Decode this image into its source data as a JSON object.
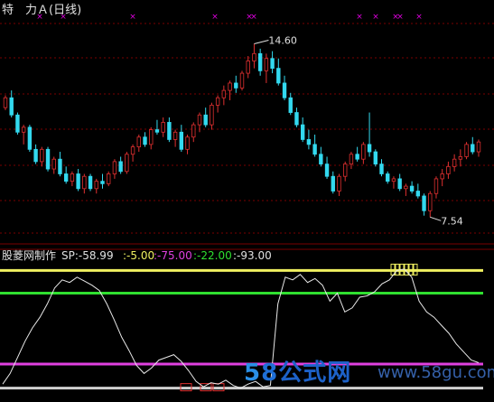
{
  "header": {
    "title": "特　力Ａ(日线)"
  },
  "price_panel": {
    "high_label": "14.60",
    "low_label": "7.54"
  },
  "indicator_header": {
    "name": "股菱网制作",
    "sp": "SP:-58.99",
    "v1": ":-5.00",
    "v2": ":-75.00",
    "v3": ":-22.00",
    "v4": ":-93.00"
  },
  "watermark": {
    "digits_a": "5",
    "digits_b": "8",
    "word": "公式网",
    "url": "www.58gu.com"
  },
  "colors": {
    "up": "#e03030",
    "down": "#33d9ef",
    "grid": "#7a0000",
    "marker": "#e000e0",
    "line_yellow": "#f0f060",
    "line_green": "#30e030",
    "line_magenta": "#e040e0",
    "line_white": "#d0d0d0"
  },
  "chart_data": [
    {
      "type": "candlestick",
      "title": "特　力Ａ(日线)",
      "annotations": [
        {
          "label": "14.60",
          "kind": "high"
        },
        {
          "label": "7.54",
          "kind": "low"
        }
      ],
      "ylim": [
        7.0,
        15.5
      ],
      "candles": [
        [
          12.0,
          12.5,
          11.9,
          12.4
        ],
        [
          12.4,
          12.7,
          11.6,
          11.7
        ],
        [
          11.7,
          11.8,
          10.9,
          11.0
        ],
        [
          11.0,
          11.3,
          10.5,
          11.2
        ],
        [
          11.2,
          11.3,
          10.2,
          10.3
        ],
        [
          10.3,
          10.5,
          9.7,
          9.8
        ],
        [
          9.8,
          10.4,
          9.6,
          10.3
        ],
        [
          10.3,
          10.4,
          9.4,
          9.5
        ],
        [
          9.5,
          10.0,
          9.3,
          9.9
        ],
        [
          9.9,
          10.2,
          9.2,
          9.3
        ],
        [
          9.3,
          9.6,
          8.9,
          9.0
        ],
        [
          9.0,
          9.4,
          8.8,
          9.3
        ],
        [
          9.3,
          9.5,
          8.6,
          8.7
        ],
        [
          8.7,
          9.3,
          8.5,
          9.2
        ],
        [
          9.2,
          9.3,
          8.6,
          8.7
        ],
        [
          8.7,
          9.1,
          8.5,
          9.0
        ],
        [
          9.0,
          9.3,
          8.7,
          8.9
        ],
        [
          8.9,
          9.4,
          8.8,
          9.3
        ],
        [
          9.3,
          9.9,
          9.1,
          9.8
        ],
        [
          9.8,
          10.0,
          9.3,
          9.4
        ],
        [
          9.4,
          10.2,
          9.3,
          10.1
        ],
        [
          10.1,
          10.5,
          9.8,
          10.4
        ],
        [
          10.4,
          10.9,
          10.2,
          10.8
        ],
        [
          10.8,
          11.0,
          10.4,
          10.5
        ],
        [
          10.5,
          11.2,
          10.3,
          11.1
        ],
        [
          11.1,
          11.5,
          10.9,
          11.0
        ],
        [
          11.0,
          11.6,
          10.8,
          11.4
        ],
        [
          11.4,
          11.6,
          10.6,
          10.7
        ],
        [
          10.7,
          11.1,
          10.4,
          11.0
        ],
        [
          11.0,
          11.3,
          10.2,
          10.3
        ],
        [
          10.3,
          10.9,
          10.1,
          10.8
        ],
        [
          10.8,
          11.4,
          10.6,
          11.3
        ],
        [
          11.3,
          11.8,
          11.0,
          11.7
        ],
        [
          11.7,
          12.0,
          11.2,
          11.3
        ],
        [
          11.3,
          12.2,
          11.1,
          12.1
        ],
        [
          12.1,
          12.5,
          11.8,
          12.4
        ],
        [
          12.4,
          12.9,
          12.1,
          12.7
        ],
        [
          12.7,
          13.1,
          12.3,
          13.0
        ],
        [
          13.0,
          13.3,
          12.6,
          12.8
        ],
        [
          12.8,
          13.5,
          12.7,
          13.4
        ],
        [
          13.4,
          14.1,
          13.2,
          13.9
        ],
        [
          13.9,
          14.6,
          13.6,
          14.2
        ],
        [
          14.2,
          14.4,
          13.3,
          13.5
        ],
        [
          13.5,
          14.2,
          13.0,
          14.0
        ],
        [
          14.0,
          14.3,
          13.4,
          13.6
        ],
        [
          13.6,
          14.0,
          12.9,
          13.0
        ],
        [
          13.0,
          13.3,
          12.3,
          12.4
        ],
        [
          12.4,
          12.6,
          11.7,
          11.8
        ],
        [
          11.8,
          12.0,
          11.2,
          11.3
        ],
        [
          11.3,
          11.6,
          10.6,
          10.7
        ],
        [
          10.7,
          11.1,
          10.3,
          10.5
        ],
        [
          10.5,
          10.9,
          10.0,
          10.1
        ],
        [
          10.1,
          10.4,
          9.6,
          9.7
        ],
        [
          9.7,
          10.0,
          9.1,
          9.2
        ],
        [
          9.2,
          9.4,
          8.5,
          8.6
        ],
        [
          8.6,
          9.3,
          8.4,
          9.2
        ],
        [
          9.2,
          9.8,
          9.0,
          9.7
        ],
        [
          9.7,
          10.2,
          9.5,
          10.1
        ],
        [
          10.1,
          10.4,
          9.8,
          9.9
        ],
        [
          9.9,
          10.6,
          9.7,
          10.5
        ],
        [
          10.5,
          11.8,
          10.0,
          10.2
        ],
        [
          10.2,
          10.3,
          9.6,
          9.7
        ],
        [
          9.7,
          9.9,
          9.2,
          9.3
        ],
        [
          9.3,
          9.4,
          8.9,
          9.0
        ],
        [
          9.0,
          9.2,
          8.7,
          9.1
        ],
        [
          9.1,
          9.3,
          8.6,
          8.7
        ],
        [
          8.7,
          8.9,
          8.4,
          8.8
        ],
        [
          8.8,
          9.0,
          8.5,
          8.6
        ],
        [
          8.6,
          8.9,
          8.3,
          8.4
        ],
        [
          8.4,
          8.5,
          7.6,
          7.8
        ],
        [
          7.8,
          8.6,
          7.54,
          8.5
        ],
        [
          8.5,
          9.2,
          8.3,
          9.1
        ],
        [
          9.1,
          9.5,
          8.8,
          9.3
        ],
        [
          9.3,
          9.8,
          9.1,
          9.6
        ],
        [
          9.6,
          10.1,
          9.4,
          9.9
        ],
        [
          9.9,
          10.3,
          9.6,
          10.0
        ],
        [
          10.0,
          10.6,
          9.9,
          10.5
        ],
        [
          10.5,
          10.8,
          10.1,
          10.2
        ],
        [
          10.2,
          10.7,
          10.0,
          10.6
        ]
      ]
    },
    {
      "type": "line",
      "title": "股菱网制作",
      "ylim": [
        -100,
        0
      ],
      "reference_lines": [
        {
          "name": "-5.00",
          "value": -5,
          "color": "#f0f060"
        },
        {
          "name": "-22.00",
          "value": -22,
          "color": "#30e030"
        },
        {
          "name": "-75.00",
          "value": -75,
          "color": "#e040e0"
        },
        {
          "name": "-93.00",
          "value": -93,
          "color": "#d0d0d0"
        }
      ],
      "series": [
        {
          "name": "SP",
          "values": [
            -90,
            -82,
            -70,
            -58,
            -48,
            -40,
            -30,
            -18,
            -12,
            -14,
            -10,
            -13,
            -16,
            -20,
            -30,
            -42,
            -55,
            -65,
            -76,
            -82,
            -78,
            -72,
            -70,
            -68,
            -73,
            -80,
            -88,
            -92,
            -89,
            -90,
            -87,
            -91,
            -93,
            -90,
            -88,
            -92,
            -91,
            -30,
            -10,
            -12,
            -8,
            -14,
            -11,
            -16,
            -28,
            -22,
            -36,
            -33,
            -25,
            -24,
            -21,
            -15,
            -12,
            -5,
            -4,
            -10,
            -28,
            -36,
            -40,
            -46,
            -52,
            -60,
            -66,
            -72,
            -74
          ]
        }
      ]
    }
  ]
}
